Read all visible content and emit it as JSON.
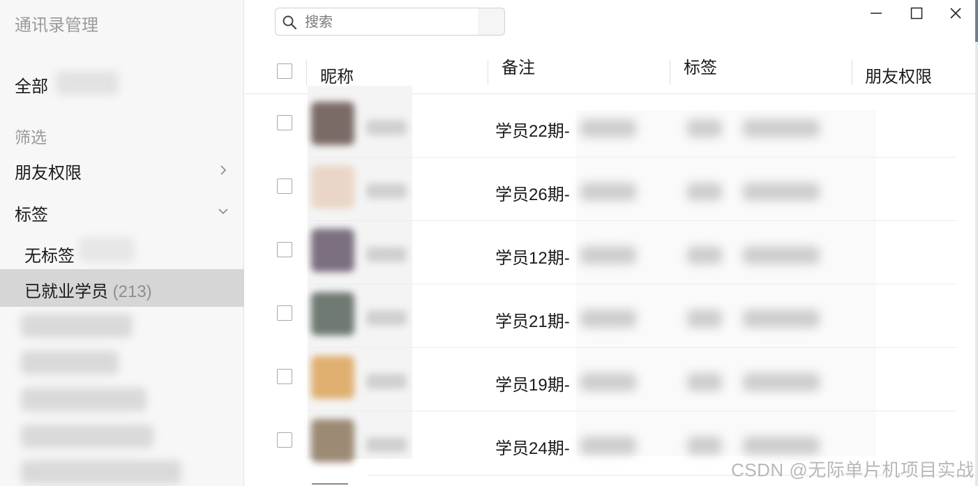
{
  "sidebar": {
    "title": "通讯录管理",
    "all_label": "全部",
    "filter_label": "筛选",
    "friend_permission_label": "朋友权限",
    "tags_label": "标签",
    "no_tag_label": "无标签",
    "selected_tag_label": "已就业学员",
    "selected_tag_count": "(213)"
  },
  "search": {
    "placeholder": "搜索"
  },
  "table": {
    "columns": [
      "昵称",
      "备注",
      "标签",
      "朋友权限"
    ],
    "rows": [
      {
        "remark": "学员22期-"
      },
      {
        "remark": "学员26期-"
      },
      {
        "remark": "学员12期-"
      },
      {
        "remark": "学员21期-"
      },
      {
        "remark": "学员19期-"
      },
      {
        "remark": "学员24期-"
      }
    ]
  },
  "watermark": "CSDN @无际单片机项目实战",
  "colors": {
    "sidebar_bg": "#f7f7f7",
    "selected_bg": "#d6d6d6",
    "muted_text": "#9a9a9a"
  }
}
